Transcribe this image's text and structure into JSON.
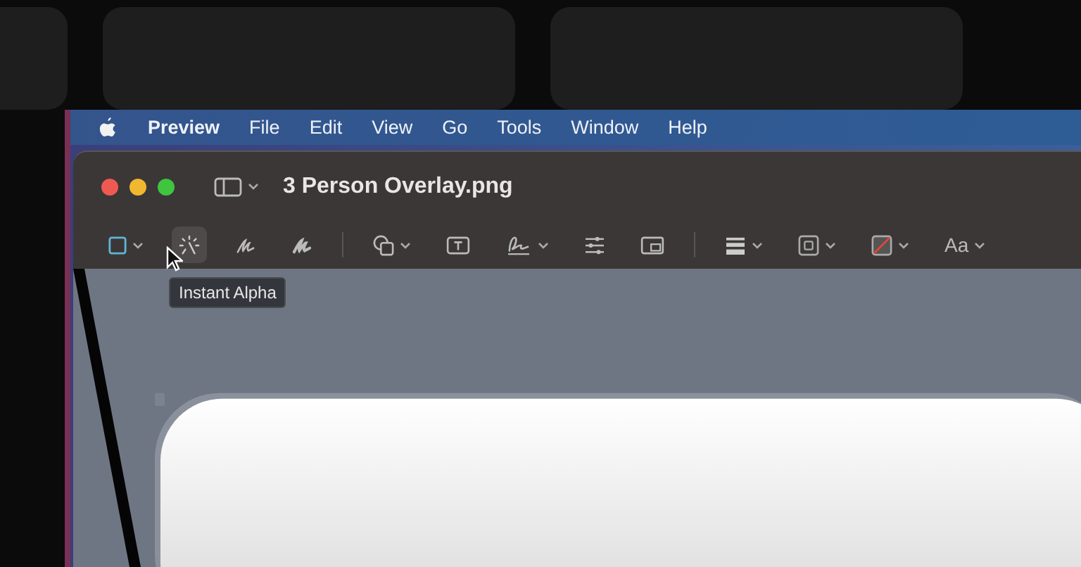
{
  "menu_bar": {
    "items": [
      {
        "label": "Preview",
        "bold": true
      },
      {
        "label": "File",
        "bold": false
      },
      {
        "label": "Edit",
        "bold": false
      },
      {
        "label": "View",
        "bold": false
      },
      {
        "label": "Go",
        "bold": false
      },
      {
        "label": "Tools",
        "bold": false
      },
      {
        "label": "Window",
        "bold": false
      },
      {
        "label": "Help",
        "bold": false
      }
    ]
  },
  "window": {
    "title": "3 Person Overlay.png"
  },
  "toolbar": {
    "groups": [
      [
        {
          "kind": "select",
          "menu": true,
          "highlighted": false
        },
        {
          "kind": "alpha",
          "menu": false,
          "highlighted": true
        },
        {
          "kind": "sketch",
          "menu": false,
          "highlighted": false
        },
        {
          "kind": "draw",
          "menu": false,
          "highlighted": false
        }
      ],
      [
        {
          "kind": "shapes",
          "menu": true,
          "highlighted": false
        },
        {
          "kind": "textbox",
          "menu": false,
          "highlighted": false
        },
        {
          "kind": "sign",
          "menu": true,
          "highlighted": false
        },
        {
          "kind": "adjust",
          "menu": false,
          "highlighted": false
        },
        {
          "kind": "size",
          "menu": false,
          "highlighted": false
        }
      ],
      [
        {
          "kind": "line",
          "menu": true,
          "highlighted": false
        },
        {
          "kind": "border",
          "menu": true,
          "highlighted": false
        },
        {
          "kind": "fill",
          "menu": true,
          "highlighted": false
        },
        {
          "kind": "text",
          "label": "Aa",
          "menu": true,
          "highlighted": false
        }
      ]
    ]
  },
  "tooltip": "Instant Alpha"
}
